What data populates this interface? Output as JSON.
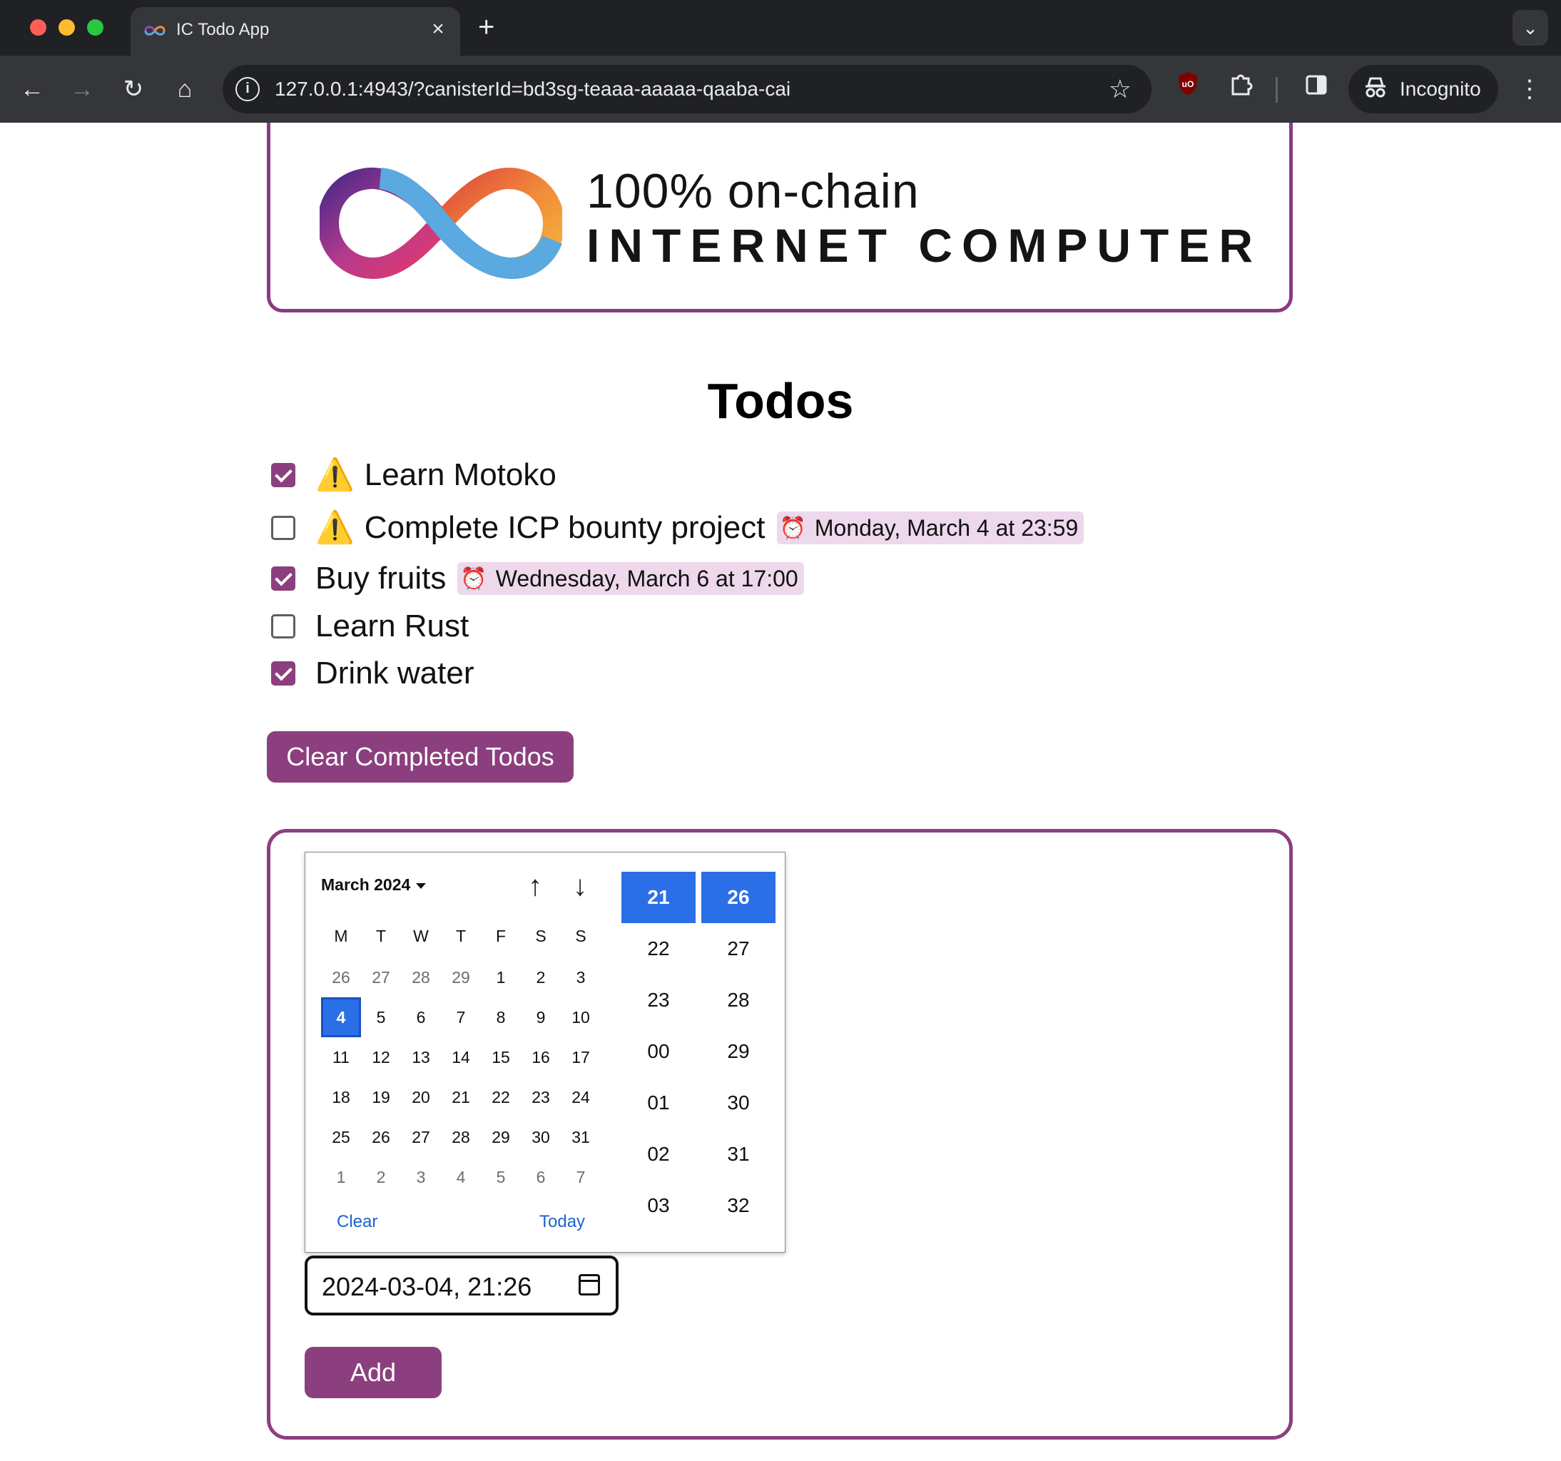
{
  "browser": {
    "tab_title": "IC Todo App",
    "tab_close": "×",
    "new_tab": "+",
    "url": "127.0.0.1:4943/?canisterId=bd3sg-teaaa-aaaaa-qaaba-cai",
    "incognito_label": "Incognito"
  },
  "banner": {
    "line1": "100% on-chain",
    "line2": "INTERNET COMPUTER"
  },
  "page": {
    "heading": "Todos",
    "todos": [
      {
        "text": "Learn Motoko",
        "done": true,
        "important": true,
        "due": ""
      },
      {
        "text": "Complete ICP bounty project",
        "done": false,
        "important": true,
        "due": "Monday, March 4 at 23:59"
      },
      {
        "text": "Buy fruits",
        "done": true,
        "important": false,
        "due": "Wednesday, March 6 at 17:00"
      },
      {
        "text": "Learn Rust",
        "done": false,
        "important": false,
        "due": ""
      },
      {
        "text": "Drink water",
        "done": true,
        "important": false,
        "due": ""
      }
    ],
    "clear_button": "Clear Completed Todos",
    "add_button": "Add",
    "datetime_value": "2024-03-04, 21:26"
  },
  "picker": {
    "month_label": "March 2024",
    "weekdays": [
      "M",
      "T",
      "W",
      "T",
      "F",
      "S",
      "S"
    ],
    "weeks": [
      [
        "26",
        "27",
        "28",
        "29",
        "1",
        "2",
        "3"
      ],
      [
        "4",
        "5",
        "6",
        "7",
        "8",
        "9",
        "10"
      ],
      [
        "11",
        "12",
        "13",
        "14",
        "15",
        "16",
        "17"
      ],
      [
        "18",
        "19",
        "20",
        "21",
        "22",
        "23",
        "24"
      ],
      [
        "25",
        "26",
        "27",
        "28",
        "29",
        "30",
        "31"
      ],
      [
        "1",
        "2",
        "3",
        "4",
        "5",
        "6",
        "7"
      ]
    ],
    "selected_day": "4",
    "clear_label": "Clear",
    "today_label": "Today",
    "hours": [
      "21",
      "22",
      "23",
      "00",
      "01",
      "02",
      "03"
    ],
    "minutes": [
      "26",
      "27",
      "28",
      "29",
      "30",
      "31",
      "32"
    ]
  },
  "colors": {
    "accent": "#8c3f7e",
    "selected_blue": "#2b6fe8",
    "due_badge": "#edd8ec"
  },
  "icons": {
    "warning": "⚠️",
    "alarm": "⏰"
  }
}
